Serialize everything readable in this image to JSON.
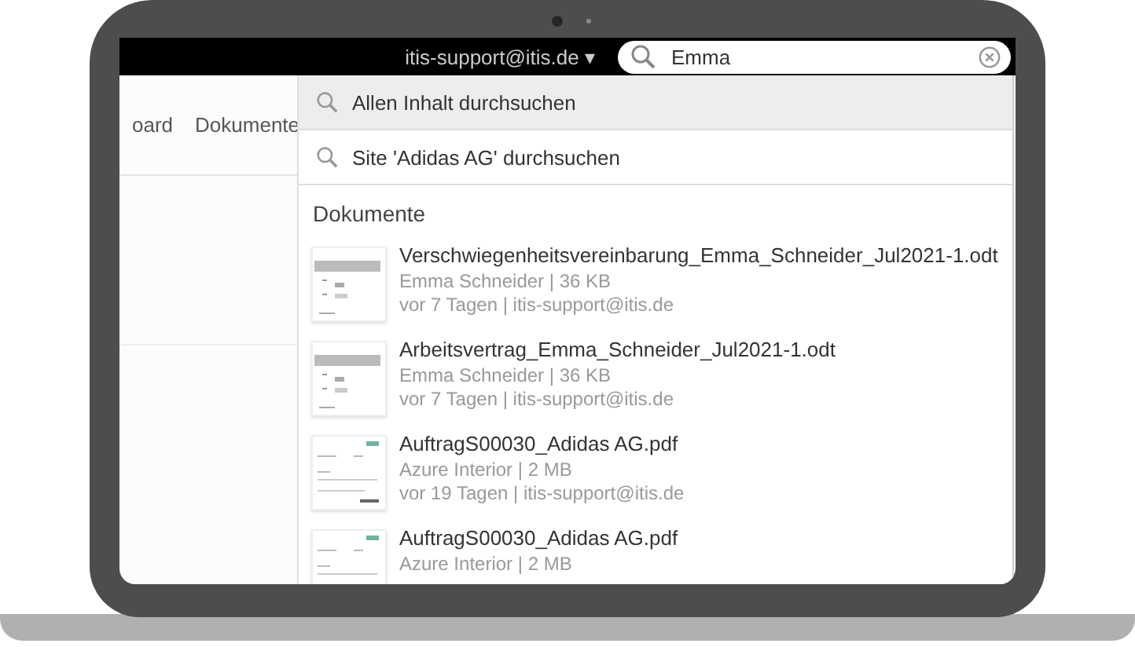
{
  "header": {
    "user": "itis-support@itis.de ▾",
    "search": {
      "value": "Emma"
    }
  },
  "nav": [
    "oard",
    "Dokumente"
  ],
  "search_options": [
    {
      "label": "Allen Inhalt durchsuchen",
      "selected": true
    },
    {
      "label": "Site 'Adidas AG' durchsuchen",
      "selected": false
    }
  ],
  "results": {
    "heading": "Dokumente",
    "items": [
      {
        "kind": "odt",
        "title": "Verschwiegenheitsvereinbarung_Emma_Schneider_Jul2021-1.odt",
        "lines": [
          "Emma Schneider | 36 KB",
          "vor 7 Tagen | itis-support@itis.de"
        ]
      },
      {
        "kind": "odt",
        "title": "Arbeitsvertrag_Emma_Schneider_Jul2021-1.odt",
        "lines": [
          "Emma Schneider | 36 KB",
          "vor 7 Tagen | itis-support@itis.de"
        ]
      },
      {
        "kind": "pdf",
        "title": "AuftragS00030_Adidas AG.pdf",
        "lines": [
          "Azure Interior | 2 MB",
          "vor 19 Tagen | itis-support@itis.de"
        ]
      },
      {
        "kind": "pdf",
        "title": "AuftragS00030_Adidas AG.pdf",
        "lines": [
          "Azure Interior | 2 MB"
        ]
      }
    ]
  }
}
